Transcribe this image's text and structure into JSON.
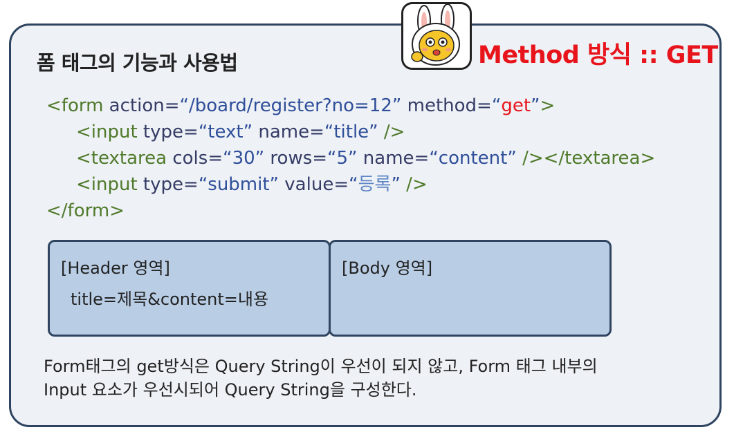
{
  "slide": {
    "title": "폼 태그의 기능과 사용법",
    "method_title": "Method 방식 :: GET"
  },
  "code": {
    "line1": {
      "open": "<form",
      "action_attr": " action=",
      "action_val": "“/board/register?no=12”",
      "method_attr": " method=",
      "method_q1": "“",
      "method_val": "get",
      "method_q2": "”",
      "close": ">"
    },
    "line2": {
      "open": "<input",
      "type_attr": " type=",
      "type_val": "“text”",
      "name_attr": " name=",
      "name_val": "“title”",
      "close": " />"
    },
    "line3": {
      "open": "<textarea",
      "cols_attr": " cols=",
      "cols_val": "“30”",
      "rows_attr": " rows=",
      "rows_val": "“5”",
      "name_attr": " name=",
      "name_val": "“content”",
      "close": " /></textarea>"
    },
    "line4": {
      "open": "<input",
      "type_attr": " type=",
      "type_val": "“submit”",
      "value_attr": " value=",
      "value_q1": "“",
      "value_val": "등록",
      "value_q2": "”",
      "close": " />"
    },
    "line5": "</form>"
  },
  "panels": {
    "header_title": "[Header 영역]",
    "header_content": "title=제목&content=내용",
    "body_title": "[Body 영역]"
  },
  "note": {
    "line1": "Form태그의 get방식은 Query String이 우선이 되지 않고, Form 태그 내부의",
    "line2": "Input 요소가 우선시되어 Query String을 구성한다."
  },
  "mascot": {
    "icon": "bunny-mascot-icon"
  }
}
